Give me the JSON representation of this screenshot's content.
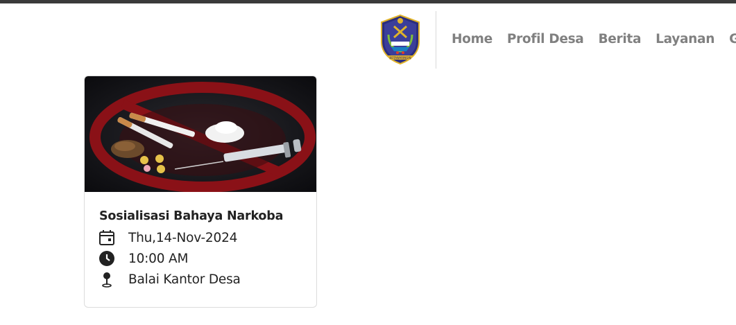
{
  "nav": {
    "items": [
      {
        "label": "Home"
      },
      {
        "label": "Profil Desa"
      },
      {
        "label": "Berita"
      },
      {
        "label": "Layanan"
      },
      {
        "label": "Gal"
      }
    ]
  },
  "logo": {
    "icon": "village-emblem-logo",
    "banner_text": "KOTAWARINGIN",
    "accent": "#2b2d7d",
    "gold": "#e0b32a"
  },
  "event_card": {
    "title": "Sosialisasi Bahaya Narkoba",
    "date": "Thu,14-Nov-2024",
    "time": "10:00 AM",
    "location": "Balai Kantor Desa",
    "date_icon": "calendar-icon",
    "time_icon": "clock-icon",
    "location_icon": "map-pin-icon",
    "image": "anti-drugs-illustration"
  },
  "colors": {
    "nav_text": "#808080",
    "top_bar": "#3a3a3a",
    "card_border": "#dcdcdc"
  }
}
